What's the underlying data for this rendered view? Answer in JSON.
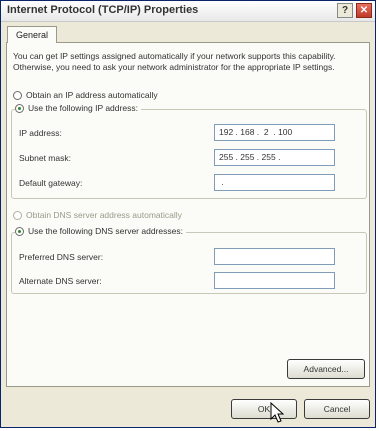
{
  "window": {
    "title": "Internet Protocol (TCP/IP) Properties",
    "help_button": "?",
    "close_button": "✕"
  },
  "tabs": [
    {
      "label": "General"
    }
  ],
  "general": {
    "description": "You can get IP settings assigned automatically if your network supports this capability. Otherwise, you need to ask your network administrator for the appropriate IP settings.",
    "auto_ip_radio": "Obtain an IP address automatically",
    "manual_ip_radio": "Use the following IP address:",
    "ip_address_label": "IP address:",
    "ip_address_value": "192 . 168 .  2  . 100",
    "subnet_mask_label": "Subnet mask:",
    "subnet_mask_value": "255 . 255 . 255 .",
    "default_gateway_label": "Default gateway:",
    "default_gateway_value": " .",
    "auto_dns_radio": "Obtain DNS server address automatically",
    "manual_dns_radio": "Use the following DNS server addresses:",
    "preferred_dns_label": "Preferred DNS server:",
    "preferred_dns_value": "",
    "alternate_dns_label": "Alternate DNS server:",
    "alternate_dns_value": "",
    "advanced_button": "Advanced..."
  },
  "footer": {
    "ok_button": "OK",
    "cancel_button": "Cancel"
  },
  "icons": {
    "radio_selected_dot": "#2a8a2a",
    "close_color": "#c0392b"
  }
}
